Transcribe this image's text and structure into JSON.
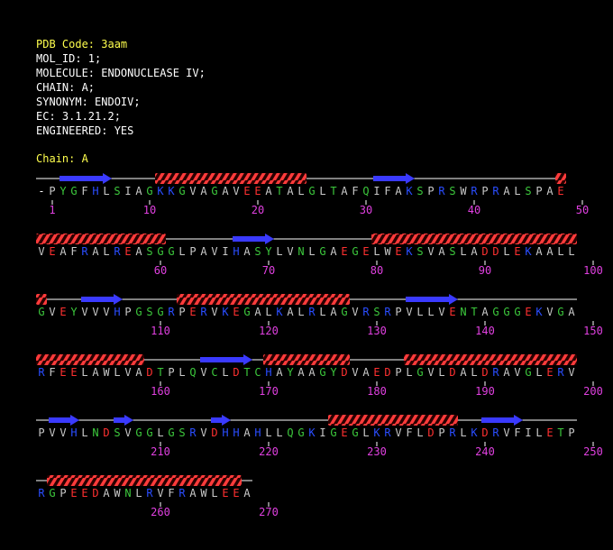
{
  "header": {
    "lines": [
      "PDB Code: 3aam",
      "MOL_ID: 1;",
      "MOLECULE: ENDONUCLEASE IV;",
      "CHAIN: A;",
      "SYNONYM: ENDOIV;",
      "EC: 3.1.21.2;",
      "ENGINEERED: YES"
    ]
  },
  "chain_label": "Chain: A",
  "colors": {
    "helix": "#ff3b3b",
    "strand": "#3a3aff",
    "coil": "#ffffff",
    "number": "#e040e0",
    "header_highlight": "#ffff4d",
    "residue_hydrophobic": "#c8c8c8",
    "residue_polar": "#3cc83c",
    "residue_basic": "#2a4dff",
    "residue_acidic": "#ff3030"
  },
  "sequence_rows": [
    {
      "residues": "-PYGFHLSIAGKKGVAGAVEEATALGLTAFQIFAKSPRSWRPRALSPAE",
      "numbers": [
        1,
        10,
        20,
        30,
        40,
        50
      ],
      "structure": "--EEEEE----HHHHHHHHHHHHHH------EEEE-------------HHH"
    },
    {
      "residues": "VEAFRALREASGGLPAVIHASYLVNLGAEGELWEKSVASLADDLEKAALL",
      "numbers": [
        60,
        70,
        80,
        90,
        100
      ],
      "structure": "HHHHHHHHHHHH------EEEE---------HHHHHHHHHHHHHHHHHHH"
    },
    {
      "residues": "GVEYVVVHPGSGRPERVKEGALKALRLAGVRSRPVLLVENTAGGGEKVGA",
      "numbers": [
        110,
        120,
        130,
        140,
        150
      ],
      "structure": "H---EEEE-----HHHHHHHHHHHHHHHH-----EEEEE-----------"
    },
    {
      "residues": "RFEELAWLVADTPLQVCLDTCHAYAAGYDVAEDPLGVLDALDRAVGLERV",
      "numbers": [
        160,
        170,
        180,
        190,
        200
      ],
      "structure": "HHHHHHHHHH-----EEEEE-HHHHHHHH-----HHHHHHHHHHHHHHHH"
    },
    {
      "residues": "PVVHLNDSVGGLGSRVDHHAHLLQGKIGEGLKRVFLDPRLKDRVFILETP",
      "numbers": [
        210,
        220,
        230,
        240,
        250
      ],
      "structure": "-EEE---EE-------EE---------HHHHHHHHHHHH--EEEE-----"
    },
    {
      "residues": "RGPEEDAWNLRVFRAWLEEA",
      "numbers": [
        260,
        270
      ],
      "structure": "-HHHHHHHHHHHHHHHHHH-"
    }
  ]
}
